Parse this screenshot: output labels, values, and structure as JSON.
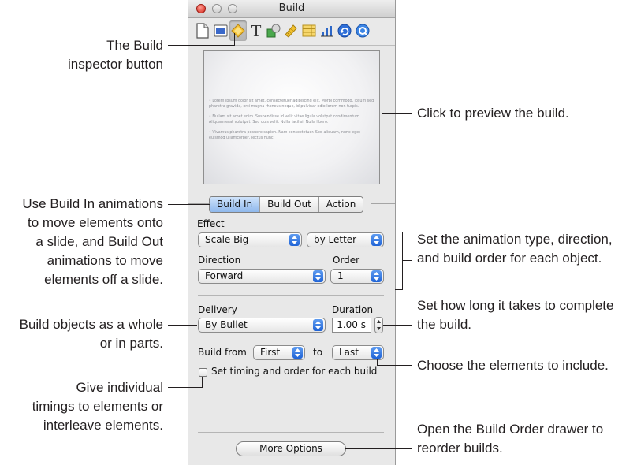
{
  "window": {
    "title": "Build"
  },
  "toolbar": {
    "buttons": [
      {
        "icon": "document-icon"
      },
      {
        "icon": "slide-icon"
      },
      {
        "icon": "build-icon",
        "active": true
      },
      {
        "icon": "text-icon"
      },
      {
        "icon": "graphic-icon"
      },
      {
        "icon": "metrics-icon"
      },
      {
        "icon": "table-icon"
      },
      {
        "icon": "chart-icon"
      },
      {
        "icon": "hyperlink-icon"
      },
      {
        "icon": "quicktime-icon"
      }
    ]
  },
  "preview": {
    "bullets": [
      "• Lorem ipsum dolor sit amet, consectetuer adipiscing elit. Morbi commodo, ipsum sed pharetra gravida, orci magna rhoncus neque, id pulvinar odio lorem non turpis.",
      "• Nullam sit amet enim. Suspendisse id velit vitae ligula volutpat condimentum. Aliquam erat volutpat. Sed quis velit. Nulla facilisi. Nulla libero.",
      "• Vivamus pharetra posuere sapien. Nam consectetuer. Sed aliquam, nunc eget euismod ullamcorper, lectus nunc"
    ]
  },
  "tabs": {
    "build_in": "Build In",
    "build_out": "Build Out",
    "action": "Action",
    "selected": "Build In"
  },
  "effect": {
    "label": "Effect",
    "value": "Scale Big",
    "sub_value": "by Letter"
  },
  "direction": {
    "label": "Direction",
    "value": "Forward"
  },
  "order": {
    "label": "Order",
    "value": "1"
  },
  "delivery": {
    "label": "Delivery",
    "value": "By Bullet"
  },
  "duration": {
    "label": "Duration",
    "value": "1.00 s"
  },
  "build_from": {
    "label": "Build from",
    "from": "First",
    "to_label": "to",
    "to": "Last"
  },
  "timing_checkbox": {
    "label": "Set timing and order for each build",
    "checked": false
  },
  "more_options": {
    "label": "More Options"
  },
  "callouts": {
    "inspector_button": [
      "The Build",
      "inspector button"
    ],
    "preview": [
      "Click to preview the build."
    ],
    "build_in_out": [
      "Use Build In animations",
      "to move elements onto",
      "a slide, and Build Out",
      "animations to move",
      "elements off a slide."
    ],
    "animation_type": [
      "Set the animation type, direction,",
      "and build order for each object."
    ],
    "duration": [
      "Set how long it takes to complete",
      "the build."
    ],
    "delivery": [
      "Build objects as a whole",
      "or in parts."
    ],
    "elements": [
      "Choose the elements to include."
    ],
    "timings": [
      "Give individual",
      "timings to elements or",
      "interleave elements."
    ],
    "build_order": [
      "Open the Build Order drawer to",
      "reorder builds."
    ]
  }
}
